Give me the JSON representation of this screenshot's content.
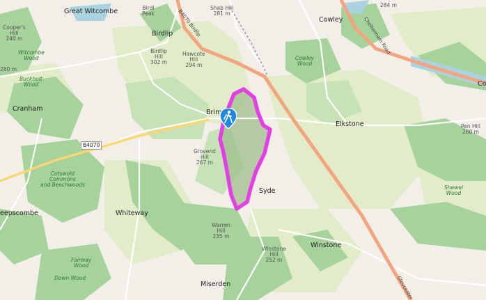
{
  "map": {
    "colors": {
      "background": "#f2efe9",
      "farmland": "#e2ecc9",
      "woodland": "#a6d29b",
      "park": "#c8e2b8",
      "water": "#aad3df",
      "major_road": "#f2a57f",
      "route": "#e43fe6",
      "marker": "#1e88e5"
    },
    "places": [
      {
        "key": "great-witcombe",
        "text": "Great Witcombe"
      },
      {
        "key": "birdlip",
        "text": "Birdlip"
      },
      {
        "key": "cowley",
        "text": "Cowley"
      },
      {
        "key": "cranham",
        "text": "Cranham"
      },
      {
        "key": "brimpsfield",
        "text": "Brim"
      },
      {
        "key": "elkstone",
        "text": "Elkstone"
      },
      {
        "key": "whiteway",
        "text": "Whiteway"
      },
      {
        "key": "syde",
        "text": "Syde"
      },
      {
        "key": "winstone",
        "text": "Winstone"
      },
      {
        "key": "miserden",
        "text": "Miserden"
      },
      {
        "key": "sheepscombe",
        "text": "eepscombe"
      },
      {
        "key": "colesbourne",
        "text": "Co"
      }
    ],
    "hills": [
      {
        "key": "shab-hill",
        "lines": [
          "Shab Hill",
          "281 m"
        ]
      },
      {
        "key": "birdlip-peak",
        "lines": [
          "Birdl",
          "Peak"
        ]
      },
      {
        "key": "birdlip-hill",
        "lines": [
          "Birdlip",
          "Hill",
          "302 m"
        ]
      },
      {
        "key": "hawcote-hill",
        "lines": [
          "Hawcote",
          "Hill",
          "294 m"
        ]
      },
      {
        "key": "cooper-hill",
        "lines": [
          "Cooper's",
          "Hill",
          "240 m"
        ]
      },
      {
        "key": "spot-280",
        "lines": [
          "280 m"
        ]
      },
      {
        "key": "grovend-hill",
        "lines": [
          "Grovend",
          "Hill",
          "267 m"
        ]
      },
      {
        "key": "pen-hill",
        "lines": [
          "Pen Hill",
          "260 m"
        ]
      },
      {
        "key": "warren-hill",
        "lines": [
          "Warren",
          "Hill",
          "235 m"
        ]
      },
      {
        "key": "winstone-hill",
        "lines": [
          "Winstone",
          "Hill",
          "252 m"
        ]
      },
      {
        "key": "spot-284",
        "lines": [
          "284 m"
        ]
      }
    ],
    "woods": [
      {
        "key": "witcombe-wood",
        "lines": [
          "Witcombe",
          "Wood"
        ]
      },
      {
        "key": "buckholt-wood",
        "lines": [
          "Buckholt",
          "Wood"
        ]
      },
      {
        "key": "cowley-wood",
        "lines": [
          "Cowley",
          "Wood"
        ]
      },
      {
        "key": "cotswold-commons",
        "lines": [
          "Cotswold",
          "Commons",
          "and Beechwoods"
        ]
      },
      {
        "key": "fairway-wood",
        "lines": [
          "Fairway",
          "Wood"
        ]
      },
      {
        "key": "down-wood",
        "lines": [
          "Down Wood"
        ]
      },
      {
        "key": "shewel-wood",
        "lines": [
          "Shewel",
          "Wood"
        ]
      }
    ],
    "roads": [
      {
        "key": "birdlip-road",
        "text": "B4070 Birdlip"
      },
      {
        "key": "cheltenham-road",
        "text": "Cheltenham Road"
      },
      {
        "key": "gloucester-road",
        "text": "Gloucester"
      },
      {
        "key": "b4070",
        "text": "B4070"
      }
    ],
    "marker": {
      "icon": "hiker-icon"
    }
  }
}
